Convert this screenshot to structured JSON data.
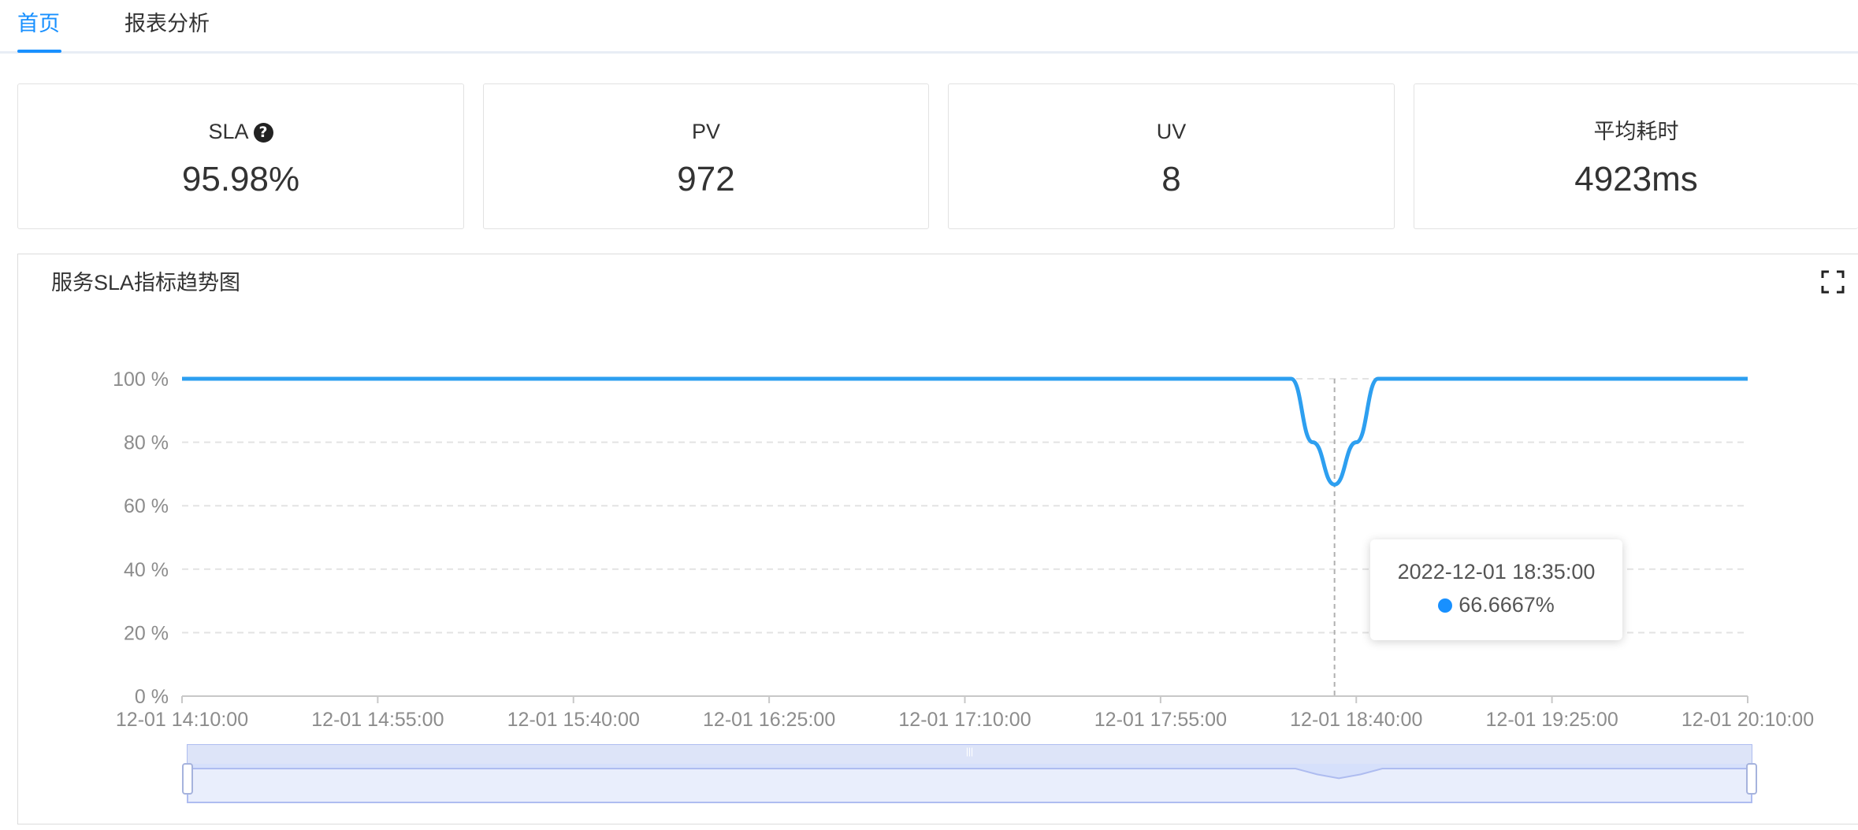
{
  "tabs": [
    {
      "label": "首页",
      "active": true
    },
    {
      "label": "报表分析",
      "active": false
    }
  ],
  "stats": [
    {
      "title": "SLA",
      "value": "95.98%",
      "help": true
    },
    {
      "title": "PV",
      "value": "972"
    },
    {
      "title": "UV",
      "value": "8"
    },
    {
      "title": "平均耗时",
      "value": "4923ms"
    }
  ],
  "panel": {
    "title": "服务SLA指标趋势图"
  },
  "colors": {
    "accent": "#1890ff",
    "line": "#2d9ff0",
    "tooltip_dot": "#1890ff",
    "zoom_fill": "#d6e0fb",
    "zoom_border": "#aebcf0"
  },
  "tooltip": {
    "time": "2022-12-01 18:35:00",
    "value": "66.6667%"
  },
  "chart_data": {
    "type": "line",
    "title": "",
    "xlabel": "",
    "ylabel": "",
    "y_tick_labels": [
      "0 %",
      "20 %",
      "40 %",
      "60 %",
      "80 %",
      "100 %"
    ],
    "ylim": [
      0,
      100
    ],
    "x_tick_labels": [
      "12-01 14:10:00",
      "12-01 14:55:00",
      "12-01 15:40:00",
      "12-01 16:25:00",
      "12-01 17:10:00",
      "12-01 17:55:00",
      "12-01 18:40:00",
      "12-01 19:25:00",
      "12-01 20:10:00"
    ],
    "xlim": [
      "12-01 14:10:00",
      "12-01 20:10:00"
    ],
    "grid": true,
    "series": [
      {
        "x": [
          "12-01 14:10:00",
          "12-01 18:25:00",
          "12-01 18:30:00",
          "12-01 18:35:00",
          "12-01 18:40:00",
          "12-01 18:45:00",
          "12-01 20:10:00"
        ],
        "values": [
          100,
          100,
          80,
          66.6667,
          80,
          100,
          100
        ]
      }
    ],
    "highlight_x": "12-01 18:35:00",
    "data_zoom": true
  }
}
